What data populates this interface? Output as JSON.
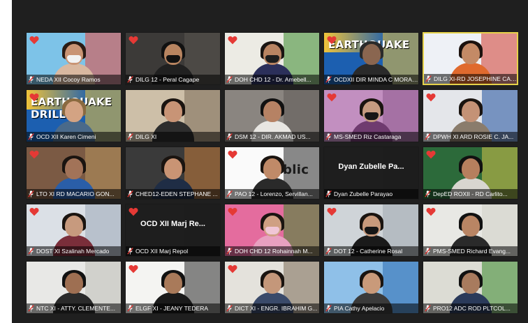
{
  "meeting": {
    "tiles": [
      {
        "name": "NEDA XII Cocoy Ramos",
        "heart": true,
        "bg": "#7dc3e8",
        "accent": "#e8473b",
        "skin": "#c99474",
        "hair": "#2a1b14",
        "shirt": "#d9b8a0",
        "mask": "#f2f2f2",
        "banner": ""
      },
      {
        "name": "DILG 12 - Peral Cagape",
        "heart": true,
        "bg": "#3c3a38",
        "accent": "#5a5550",
        "skin": "#b78460",
        "hair": "#111111",
        "shirt": "#202020",
        "mask": "#111111",
        "banner": ""
      },
      {
        "name": "DOH CHD 12 - Dr. Amebell...",
        "heart": true,
        "bg": "#ecebe4",
        "accent": "#3a8a2c",
        "skin": "#b88462",
        "hair": "#1a1512",
        "shirt": "#2b2f5a",
        "mask": "#1e1e1e",
        "banner": ""
      },
      {
        "name": "OCDXII DIR MINDA C MORAN...",
        "heart": true,
        "bg": "#1c5fb0",
        "accent": "#f0c33a",
        "skin": "#8a6650",
        "hair": "#2a2a2a",
        "shirt": "#2a2a2a",
        "mask": "",
        "banner": "EARTHQUAKE"
      },
      {
        "name": "DILG XI-RD JOSEPHINE CABR...",
        "heart": false,
        "bg": "#eef1f6",
        "accent": "#d23b2d",
        "skin": "#c48a66",
        "hair": "#1c120e",
        "shirt": "#e06a2e",
        "mask": "",
        "banner": ""
      },
      {
        "name": "OCD XII Karen Cimeni",
        "heart": true,
        "bg": "#1c5fb0",
        "accent": "#f0c33a",
        "skin": "#d3a383",
        "hair": "#8a6a40",
        "shirt": "#4a6a8a",
        "mask": "",
        "banner": "EARTHQUAKE DRILL"
      },
      {
        "name": "DILG XI",
        "heart": false,
        "bg": "#cdbfa8",
        "accent": "#7a6a55",
        "skin": "#c89476",
        "hair": "#1a1410",
        "shirt": "#2d2d2d",
        "mask": "",
        "banner": ""
      },
      {
        "name": "DSM 12 - DIR. AKMAD US...",
        "heart": false,
        "bg": "#8a8580",
        "accent": "#5e5a56",
        "skin": "#b68264",
        "hair": "#111111",
        "shirt": "#e8e6e2",
        "mask": "",
        "banner": ""
      },
      {
        "name": "MS-SMED Riz Castaraga",
        "heart": true,
        "bg": "#c28fc0",
        "accent": "#8e5a8c",
        "skin": "#c59b80",
        "hair": "#1a1410",
        "shirt": "#6f3b6f",
        "mask": "#161616",
        "banner": ""
      },
      {
        "name": "DPWH XI ARD ROSIE C. JA...",
        "heart": true,
        "bg": "#e4e6ea",
        "accent": "#1d4f9c",
        "skin": "#c49276",
        "hair": "#1a1410",
        "shirt": "#8a7c6c",
        "mask": "",
        "banner": ""
      },
      {
        "name": "LTO XI RD MACARIO GON...",
        "heart": true,
        "bg": "#7b5a44",
        "accent": "#b8965f",
        "skin": "#a27358",
        "hair": "#1a1410",
        "shirt": "#2a5ea8",
        "mask": "",
        "banner": ""
      },
      {
        "name": "CHED12-EDEN STEPHANE ...",
        "heart": false,
        "bg": "#3a3a3a",
        "accent": "#c47b3a",
        "skin": "#c99474",
        "hair": "#1a1410",
        "shirt": "#1f2d45",
        "mask": "",
        "banner": ""
      },
      {
        "name": "PAO 12 - Lorenzo, Servillan...",
        "heart": true,
        "bg": "#fafafa",
        "accent": "#2a2a2a",
        "skin": "#c08a68",
        "hair": "#1a1410",
        "shirt": "#2a2a2a",
        "mask": "",
        "banner": "ublic"
      },
      {
        "name": "Dyan Zubelle Parayao",
        "heart": false,
        "bg": "#1e1e1e",
        "accent": "#1e1e1e",
        "skin": "",
        "hair": "",
        "shirt": "",
        "mask": "",
        "banner": "",
        "bigname": "Dyan Zubelle Pa..."
      },
      {
        "name": "DepED ROXII - RD Carlito...",
        "heart": true,
        "bg": "#2c6a3a",
        "accent": "#d6c24a",
        "skin": "#b67f5e",
        "hair": "#111111",
        "shirt": "#d8d6d0",
        "mask": "",
        "banner": ""
      },
      {
        "name": "DOST XI Szalinah Mercado",
        "heart": true,
        "bg": "#dbe0e6",
        "accent": "#9aa8b6",
        "skin": "#c79a7e",
        "hair": "#1a1410",
        "shirt": "#7a2e3a",
        "mask": "",
        "banner": ""
      },
      {
        "name": "OCD XII Marj Repol",
        "heart": true,
        "bg": "#1e1e1e",
        "accent": "#1e1e1e",
        "skin": "",
        "hair": "",
        "shirt": "",
        "mask": "",
        "banner": "",
        "bigname": "OCD XII Marj Re..."
      },
      {
        "name": "DOH CHD 12 Rohainnah M...",
        "heart": true,
        "bg": "#e46c9e",
        "accent": "#3a8a2c",
        "skin": "#cfa083",
        "hair": "#1a1410",
        "shirt": "#e8a0c0",
        "mask": "#f0c6d6",
        "banner": ""
      },
      {
        "name": "DOT 12 - Catherine Rosal",
        "heart": true,
        "bg": "#cfd4d8",
        "accent": "#a0a8b0",
        "skin": "#c89a7c",
        "hair": "#1a1410",
        "shirt": "#1a1a1a",
        "mask": "#161616",
        "banner": ""
      },
      {
        "name": "PMS-SMED Richard Evang...",
        "heart": true,
        "bg": "#e8e8e4",
        "accent": "#cfcfc6",
        "skin": "#b98564",
        "hair": "#111111",
        "shirt": "#2a2a2a",
        "mask": "",
        "banner": ""
      },
      {
        "name": "NTC XI - ATTY. CLEMENTE...",
        "heart": false,
        "bg": "#e8e8e6",
        "accent": "#bdbdb6",
        "skin": "#9e6f52",
        "hair": "#111111",
        "shirt": "#2a2a2a",
        "mask": "",
        "banner": ""
      },
      {
        "name": "ELGF XI - JEANY TEDERA",
        "heart": true,
        "bg": "#f4f4f2",
        "accent": "#2a2a2a",
        "skin": "#a97a5a",
        "hair": "#111111",
        "shirt": "#1a1a1a",
        "mask": "",
        "banner": ""
      },
      {
        "name": "DICT XI - ENGR. IBRAHIM G...",
        "heart": true,
        "bg": "#e4e2dc",
        "accent": "#7a6a55",
        "skin": "#c4977a",
        "hair": "#1a1410",
        "shirt": "#3a4a6a",
        "mask": "",
        "banner": ""
      },
      {
        "name": "PIA Cathy Apelacio",
        "heart": false,
        "bg": "#8fc0e8",
        "accent": "#2a6ab0",
        "skin": "#c99a7a",
        "hair": "#1a1410",
        "shirt": "#3a3a3a",
        "mask": "",
        "banner": ""
      },
      {
        "name": "PRO12 ADC ROD PLTCOL...",
        "heart": false,
        "bg": "#dcdcd4",
        "accent": "#3a8a2c",
        "skin": "#a87b5e",
        "hair": "#111111",
        "shirt": "#2a3a5a",
        "mask": "",
        "banner": ""
      }
    ]
  }
}
